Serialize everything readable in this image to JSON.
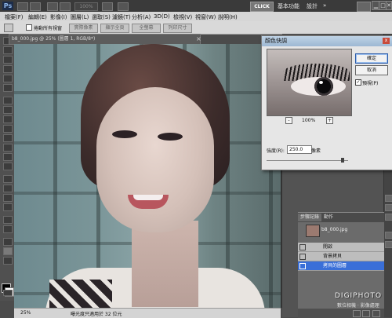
{
  "app": {
    "logo": "Ps",
    "zoom": "100%",
    "click_label": "CLICK",
    "workspace_label": "基本功能",
    "design_label": "設計",
    "more": "»"
  },
  "window_controls": {
    "minimize": "▁",
    "maximize": "□",
    "close": "✕"
  },
  "menu": {
    "items": [
      "檔案(F)",
      "編輯(E)",
      "影像(I)",
      "圖層(L)",
      "選取(S)",
      "濾鏡(T)",
      "分析(A)",
      "3D(D)",
      "檢視(V)",
      "視窗(W)",
      "說明(H)"
    ]
  },
  "options": {
    "scroll_all_label": "捲動所有視窗",
    "actual_pixels": "實際像素",
    "fit_screen": "顯示全頁",
    "fill_screen": "全螢幕",
    "print_size": "列印尺寸"
  },
  "document": {
    "tab_title": "b8_000.jpg @ 25% (圖層 1, RGB/8*)",
    "close": "×"
  },
  "status": {
    "zoom": "25%",
    "info": "曝光度只適用於 32 位元"
  },
  "dialog": {
    "title": "顏色快調",
    "close": "x",
    "zoom_minus": "-",
    "zoom_plus": "+",
    "zoom_pct": "100%",
    "radius_label": "強度(R):",
    "radius_value": "250.0",
    "radius_unit": "像素",
    "radius_fraction": 0.95,
    "ok": "確定",
    "cancel": "取消",
    "preview_label": "預視(P)",
    "preview_checked": "✓"
  },
  "layers": {
    "tabs": [
      "步驟記錄",
      "動作"
    ],
    "snapshot_name": "b8_000.jpg",
    "rows": [
      {
        "name": "開啟"
      },
      {
        "name": "背景拷貝"
      },
      {
        "name": "拷貝的圖層"
      }
    ]
  },
  "watermark": {
    "brand": "DIGIPHOTO",
    "sub": "數位相機 · 影像處理"
  },
  "colors": {
    "accent": "#3a6fd8",
    "title_bar": "#3a3a3a",
    "menu_bg": "#d6d6d6"
  }
}
